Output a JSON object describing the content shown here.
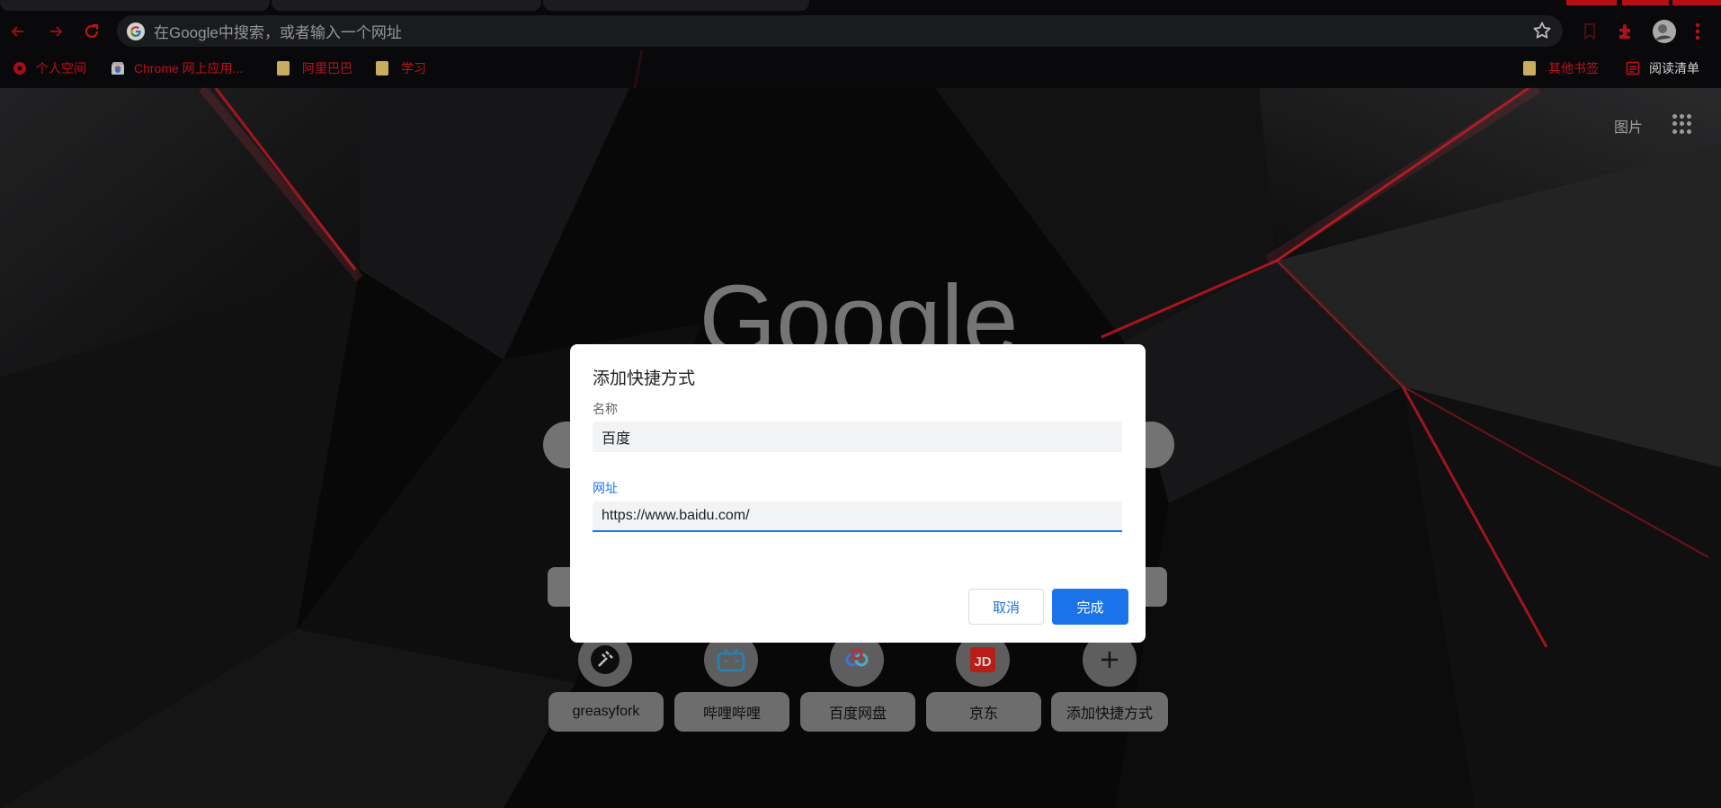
{
  "colors": {
    "accent_red": "#e0101a",
    "dialog_blue": "#1a73e8",
    "bookmark_red": "#e8141f"
  },
  "omnibox": {
    "placeholder": "在Google中搜索，或者输入一个网址",
    "left_icon": "google-g-icon",
    "right_icon": "star-icon"
  },
  "toolbar_icons": [
    "back-arrow-icon",
    "forward-arrow-icon",
    "reload-icon",
    "bookmark-icon",
    "extensions-icon",
    "profile-avatar-icon",
    "menu-dots-icon"
  ],
  "bookmarks": {
    "items": [
      {
        "label": "个人空间",
        "icon": "gear-favicon-icon"
      },
      {
        "label": "Chrome 网上应用...",
        "icon": "chrome-webstore-icon"
      },
      {
        "label": "阿里巴巴",
        "icon": "folder-icon"
      },
      {
        "label": "学习",
        "icon": "folder-icon"
      }
    ],
    "other_bookmarks": "其他书签",
    "reading_list": "阅读清单"
  },
  "ntp": {
    "images_link": "图片",
    "logo_text": "Google",
    "shortcuts": [
      {
        "label": "greasyfork",
        "icon": "greasyfork-icon"
      },
      {
        "label": "哔哩哔哩",
        "icon": "bilibili-icon"
      },
      {
        "label": "百度网盘",
        "icon": "baidu-netdisk-icon"
      },
      {
        "label": "京东",
        "icon": "jd-icon"
      },
      {
        "label": "添加快捷方式",
        "icon": "plus-icon"
      }
    ]
  },
  "dialog": {
    "title": "添加快捷方式",
    "name_label": "名称",
    "name_value": "百度",
    "url_label": "网址",
    "url_value": "https://www.baidu.com/",
    "cancel_label": "取消",
    "done_label": "完成"
  }
}
